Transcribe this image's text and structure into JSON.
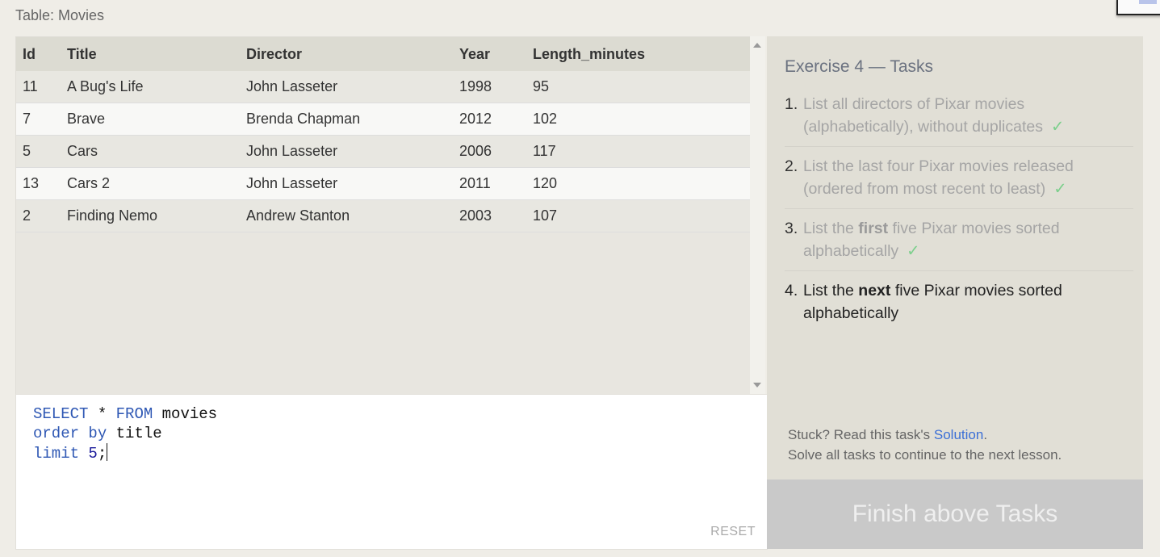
{
  "table_caption": "Table: Movies",
  "results": {
    "columns": [
      "Id",
      "Title",
      "Director",
      "Year",
      "Length_minutes"
    ],
    "rows": [
      [
        "11",
        "A Bug's Life",
        "John Lasseter",
        "1998",
        "95"
      ],
      [
        "7",
        "Brave",
        "Brenda Chapman",
        "2012",
        "102"
      ],
      [
        "5",
        "Cars",
        "John Lasseter",
        "2006",
        "117"
      ],
      [
        "13",
        "Cars 2",
        "John Lasseter",
        "2011",
        "120"
      ],
      [
        "2",
        "Finding Nemo",
        "Andrew Stanton",
        "2003",
        "107"
      ]
    ]
  },
  "editor": {
    "lines": [
      [
        {
          "t": "SELECT",
          "k": "kw"
        },
        {
          "t": " * ",
          "k": ""
        },
        {
          "t": "FROM",
          "k": "kw"
        },
        {
          "t": " movies",
          "k": ""
        }
      ],
      [
        {
          "t": "order",
          "k": "kw"
        },
        {
          "t": " ",
          "k": ""
        },
        {
          "t": "by",
          "k": "kw"
        },
        {
          "t": " title",
          "k": ""
        }
      ],
      [
        {
          "t": "limit",
          "k": "kw"
        },
        {
          "t": " ",
          "k": ""
        },
        {
          "t": "5",
          "k": "num"
        },
        {
          "t": ";",
          "k": ""
        }
      ]
    ],
    "reset_label": "RESET"
  },
  "tasks": {
    "title": "Exercise 4 — Tasks",
    "items": [
      {
        "n": "1.",
        "parts": [
          {
            "t": "List all directors of Pixar movies (alphabetically), without duplicates"
          }
        ],
        "done": true
      },
      {
        "n": "2.",
        "parts": [
          {
            "t": "List the last four Pixar movies released (ordered from most recent to least)"
          }
        ],
        "done": true
      },
      {
        "n": "3.",
        "parts": [
          {
            "t": "List the "
          },
          {
            "t": "first",
            "b": true
          },
          {
            "t": " five Pixar movies sorted alphabetically"
          }
        ],
        "done": true
      },
      {
        "n": "4.",
        "parts": [
          {
            "t": "List the "
          },
          {
            "t": "next",
            "b": true
          },
          {
            "t": " five Pixar movies sorted alphabetically"
          }
        ],
        "done": false
      }
    ],
    "check_mark": "✓",
    "stuck_prefix": "Stuck? Read this task's ",
    "solution_link": "Solution",
    "stuck_suffix": ".",
    "continue_text": "Solve all tasks to continue to the next lesson."
  },
  "finish_button": "Finish above Tasks"
}
